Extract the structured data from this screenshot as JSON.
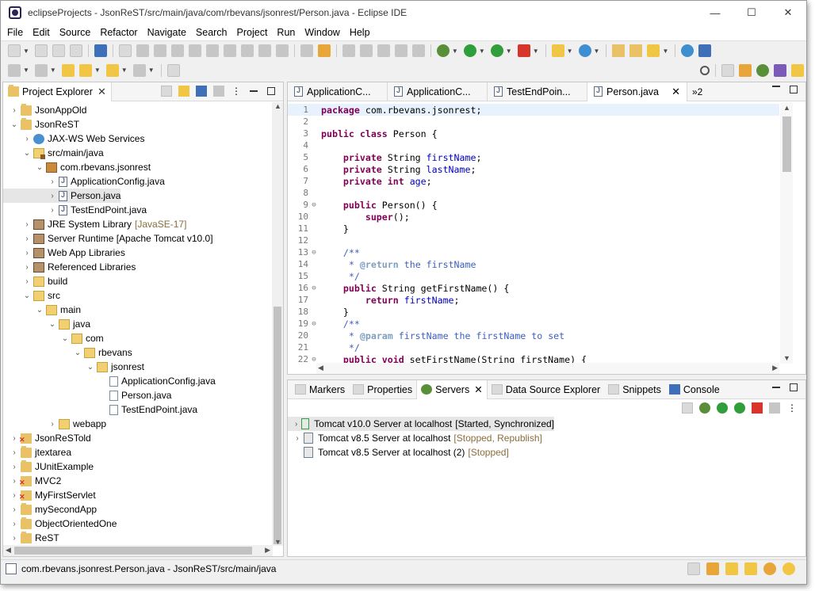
{
  "window": {
    "title": "eclipseProjects - JsonReST/src/main/java/com/rbevans/jsonrest/Person.java - Eclipse IDE"
  },
  "menu": [
    "File",
    "Edit",
    "Source",
    "Refactor",
    "Navigate",
    "Search",
    "Project",
    "Run",
    "Window",
    "Help"
  ],
  "project_explorer": {
    "tab_label": "Project Explorer",
    "tree": [
      {
        "label": "JsonAppOld",
        "decor": "",
        "icon": "project",
        "twisty": "›",
        "level": 0
      },
      {
        "label": "JsonReST",
        "decor": "",
        "icon": "project",
        "twisty": "⌄",
        "level": 0
      },
      {
        "label": "JAX-WS Web Services",
        "decor": "",
        "icon": "webservice",
        "twisty": "›",
        "level": 1
      },
      {
        "label": "src/main/java",
        "decor": "",
        "icon": "srcfolder",
        "twisty": "⌄",
        "level": 1
      },
      {
        "label": "com.rbevans.jsonrest",
        "decor": "",
        "icon": "package",
        "twisty": "⌄",
        "level": 2
      },
      {
        "label": "ApplicationConfig.java",
        "decor": "",
        "icon": "java",
        "twisty": "›",
        "level": 3
      },
      {
        "label": "Person.java",
        "decor": "",
        "icon": "java",
        "twisty": "›",
        "level": 3,
        "selected": true
      },
      {
        "label": "TestEndPoint.java",
        "decor": "",
        "icon": "java",
        "twisty": "›",
        "level": 3
      },
      {
        "label": "JRE System Library",
        "decor": "[JavaSE-17]",
        "icon": "library",
        "twisty": "›",
        "level": 1
      },
      {
        "label": "Server Runtime [Apache Tomcat v10.0]",
        "decor": "",
        "icon": "library",
        "twisty": "›",
        "level": 1
      },
      {
        "label": "Web App Libraries",
        "decor": "",
        "icon": "library",
        "twisty": "›",
        "level": 1
      },
      {
        "label": "Referenced Libraries",
        "decor": "",
        "icon": "library",
        "twisty": "›",
        "level": 1
      },
      {
        "label": "build",
        "decor": "",
        "icon": "folder",
        "twisty": "›",
        "level": 1
      },
      {
        "label": "src",
        "decor": "",
        "icon": "folder",
        "twisty": "⌄",
        "level": 1
      },
      {
        "label": "main",
        "decor": "",
        "icon": "folder",
        "twisty": "⌄",
        "level": 2
      },
      {
        "label": "java",
        "decor": "",
        "icon": "folder",
        "twisty": "⌄",
        "level": 3
      },
      {
        "label": "com",
        "decor": "",
        "icon": "folder",
        "twisty": "⌄",
        "level": 4
      },
      {
        "label": "rbevans",
        "decor": "",
        "icon": "folder",
        "twisty": "⌄",
        "level": 5
      },
      {
        "label": "jsonrest",
        "decor": "",
        "icon": "folder",
        "twisty": "⌄",
        "level": 6
      },
      {
        "label": "ApplicationConfig.java",
        "decor": "",
        "icon": "file",
        "twisty": "",
        "level": 7
      },
      {
        "label": "Person.java",
        "decor": "",
        "icon": "file",
        "twisty": "",
        "level": 7
      },
      {
        "label": "TestEndPoint.java",
        "decor": "",
        "icon": "file",
        "twisty": "",
        "level": 7
      },
      {
        "label": "webapp",
        "decor": "",
        "icon": "folder",
        "twisty": "›",
        "level": 3
      },
      {
        "label": "JsonReSTold",
        "decor": "",
        "icon": "project-error",
        "twisty": "›",
        "level": 0
      },
      {
        "label": "jtextarea",
        "decor": "",
        "icon": "project",
        "twisty": "›",
        "level": 0
      },
      {
        "label": "JUnitExample",
        "decor": "",
        "icon": "project",
        "twisty": "›",
        "level": 0
      },
      {
        "label": "MVC2",
        "decor": "",
        "icon": "project-error",
        "twisty": "›",
        "level": 0
      },
      {
        "label": "MyFirstServlet",
        "decor": "",
        "icon": "project-error",
        "twisty": "›",
        "level": 0
      },
      {
        "label": "mySecondApp",
        "decor": "",
        "icon": "project",
        "twisty": "›",
        "level": 0
      },
      {
        "label": "ObjectOrientedOne",
        "decor": "",
        "icon": "project",
        "twisty": "›",
        "level": 0
      },
      {
        "label": "ReST",
        "decor": "",
        "icon": "project",
        "twisty": "›",
        "level": 0
      }
    ]
  },
  "editor": {
    "tabs": [
      {
        "label": "ApplicationC...",
        "active": false
      },
      {
        "label": "ApplicationC...",
        "active": false
      },
      {
        "label": "TestEndPoin...",
        "active": false
      },
      {
        "label": "Person.java",
        "active": true
      }
    ],
    "overflow_label": "»2",
    "lines": [
      {
        "n": "1",
        "fold": "",
        "html": "<span class='kw'>package</span> com.rbevans.jsonrest;",
        "hl": true
      },
      {
        "n": "2",
        "fold": "",
        "html": ""
      },
      {
        "n": "3",
        "fold": "",
        "html": "<span class='kw'>public class</span> Person {"
      },
      {
        "n": "4",
        "fold": "",
        "html": ""
      },
      {
        "n": "5",
        "fold": "",
        "html": "    <span class='kw'>private</span> String <span class='fld'>firstName</span>;"
      },
      {
        "n": "6",
        "fold": "",
        "html": "    <span class='kw'>private</span> String <span class='fld'>lastName</span>;"
      },
      {
        "n": "7",
        "fold": "",
        "html": "    <span class='kw'>private int</span> <span class='fld'>age</span>;"
      },
      {
        "n": "8",
        "fold": "",
        "html": ""
      },
      {
        "n": "9",
        "fold": "⊖",
        "html": "    <span class='kw'>public</span> Person() {"
      },
      {
        "n": "10",
        "fold": "",
        "html": "        <span class='kw'>super</span>();"
      },
      {
        "n": "11",
        "fold": "",
        "html": "    }"
      },
      {
        "n": "12",
        "fold": "",
        "html": ""
      },
      {
        "n": "13",
        "fold": "⊖",
        "html": "    <span class='cmt'>/**</span>"
      },
      {
        "n": "14",
        "fold": "",
        "html": "<span class='cmt'>     * </span><span class='tag'>@return</span><span class='cmt'> the firstName</span>"
      },
      {
        "n": "15",
        "fold": "",
        "html": "<span class='cmt'>     */</span>"
      },
      {
        "n": "16",
        "fold": "⊖",
        "html": "    <span class='kw'>public</span> String getFirstName() {"
      },
      {
        "n": "17",
        "fold": "",
        "html": "        <span class='kw'>return</span> <span class='fld'>firstName</span>;"
      },
      {
        "n": "18",
        "fold": "",
        "html": "    }"
      },
      {
        "n": "19",
        "fold": "⊖",
        "html": "    <span class='cmt'>/**</span>"
      },
      {
        "n": "20",
        "fold": "",
        "html": "<span class='cmt'>     * </span><span class='tag'>@param</span><span class='cmt'> firstName the firstName to set</span>"
      },
      {
        "n": "21",
        "fold": "",
        "html": "<span class='cmt'>     */</span>"
      },
      {
        "n": "22",
        "fold": "⊖",
        "html": "    <span class='kw'>public void</span> setFirstName(String firstName) {"
      }
    ]
  },
  "servers_view": {
    "tabs": [
      {
        "label": "Markers",
        "active": false
      },
      {
        "label": "Properties",
        "active": false
      },
      {
        "label": "Servers",
        "active": true
      },
      {
        "label": "Data Source Explorer",
        "active": false
      },
      {
        "label": "Snippets",
        "active": false
      },
      {
        "label": "Console",
        "active": false
      }
    ],
    "servers": [
      {
        "name": "Tomcat v10.0 Server at localhost",
        "status": "[Started, Synchronized]",
        "selected": true,
        "twisty": "›"
      },
      {
        "name": "Tomcat v8.5 Server at localhost",
        "status": "[Stopped, Republish]",
        "selected": false,
        "twisty": "›"
      },
      {
        "name": "Tomcat v8.5 Server at localhost (2)",
        "status": "[Stopped]",
        "selected": false,
        "twisty": ""
      }
    ]
  },
  "statusbar": {
    "text": "com.rbevans.jsonrest.Person.java - JsonReST/src/main/java"
  },
  "colors": {
    "keyword": "#7f0055",
    "field": "#0000c0",
    "comment": "#3f5fbf",
    "decoration": "#8a6d3b",
    "current_line": "#e8f2fe"
  }
}
